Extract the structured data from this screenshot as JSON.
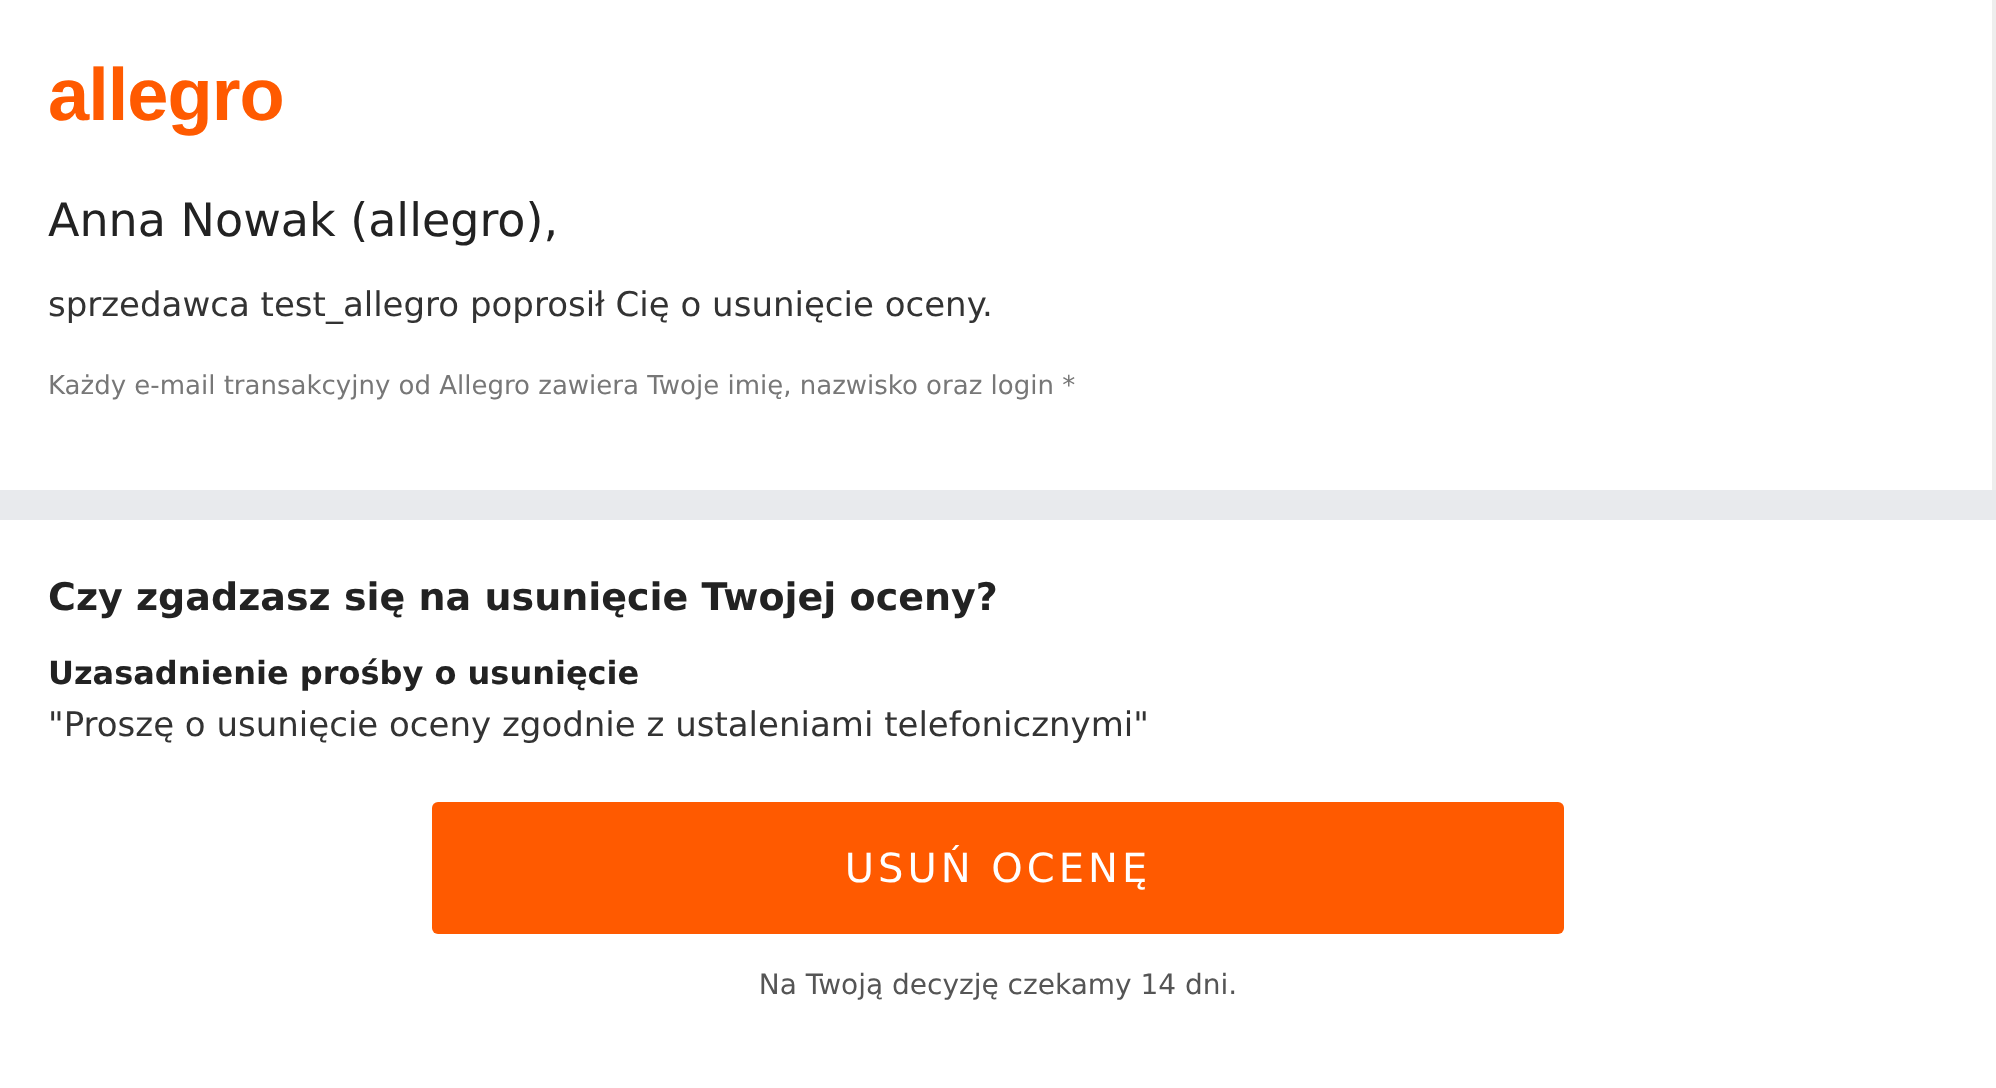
{
  "logo": "allegro",
  "greeting": "Anna Nowak (allegro),",
  "message": "sprzedawca test_allegro poprosił Cię o usunięcie oceny.",
  "notice": "Każdy e-mail transakcyjny od Allegro zawiera Twoje imię, nazwisko oraz login *",
  "question": "Czy zgadzasz się na usunięcie Twojej oceny?",
  "reason_label": "Uzasadnienie prośby o usunięcie",
  "reason": "\"Proszę o usunięcie oceny zgodnie z ustaleniami telefonicznymi\"",
  "button": "USUŃ OCENĘ",
  "footnote": "Na Twoją decyzję czekamy 14 dni."
}
